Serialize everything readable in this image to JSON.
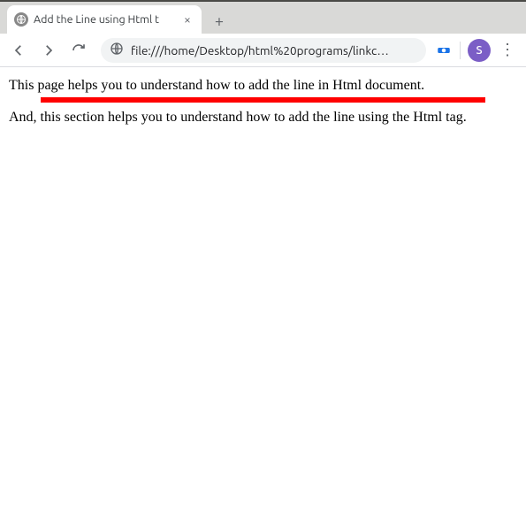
{
  "window": {
    "tab_title": "Add the Line using Html t",
    "url_display": "file:///home/Desktop/html%20programs/linkc…"
  },
  "avatar": {
    "letter": "S"
  },
  "page": {
    "paragraph1": "This page helps you to understand how to add the line in Html document.",
    "paragraph2": "And, this section helps you to understand how to add the line using the Html tag.",
    "hr_color": "#ff0000"
  }
}
